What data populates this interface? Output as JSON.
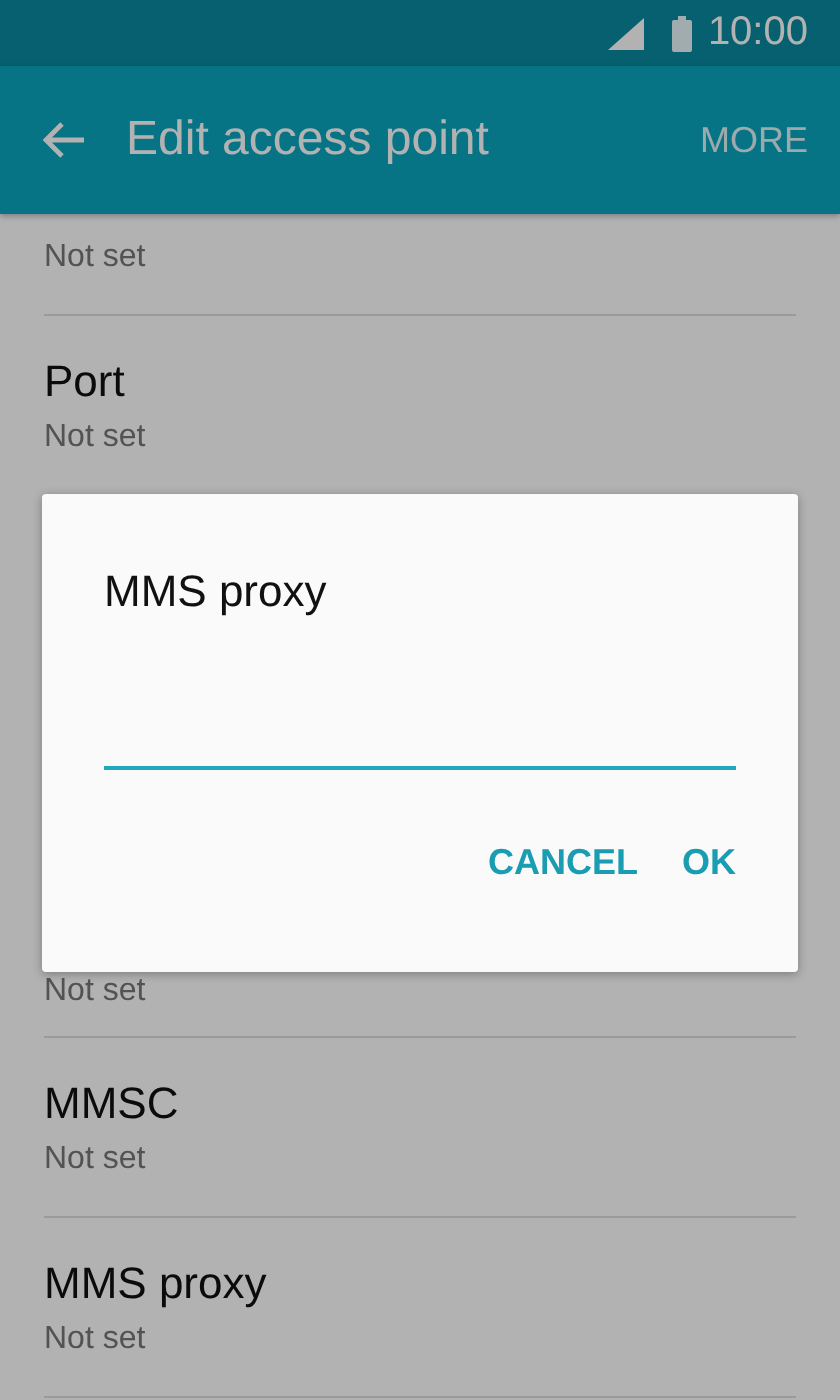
{
  "status_bar": {
    "time": "10:00"
  },
  "app_bar": {
    "title": "Edit access point",
    "action": "MORE"
  },
  "settings": [
    {
      "value": "Not set"
    },
    {
      "title": "Port",
      "value": "Not set"
    },
    {
      "value": "Not set"
    },
    {
      "title": "MMSC",
      "value": "Not set"
    },
    {
      "title": "MMS proxy",
      "value": "Not set"
    }
  ],
  "dialog": {
    "title": "MMS proxy",
    "buttons": [
      "CANCEL",
      "OK"
    ]
  }
}
